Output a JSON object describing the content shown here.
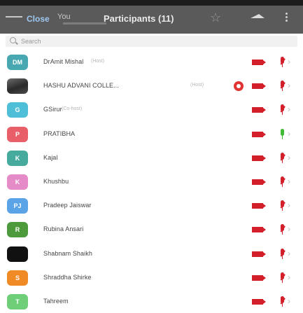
{
  "header": {
    "close_label": "Close",
    "you_label": "You",
    "title": "Participants (11)"
  },
  "search": {
    "placeholder": "Search"
  },
  "colors": {
    "header_bg": "#5a5a5a",
    "muted_red": "#d21f2a",
    "unmuted_green": "#3fba34"
  },
  "participants": [
    {
      "initials": "DM",
      "name": "DrAmit Mishal",
      "tag": "(Host)",
      "avatar_color": "#48a8b2",
      "avatar_type": "initials",
      "video": "off",
      "mic": "muted",
      "recording": false
    },
    {
      "initials": "",
      "name": "HASHU ADVANI COLLE...",
      "tag": "(Host)",
      "avatar_color": "#3a3a3a",
      "avatar_type": "photo",
      "video": "off",
      "mic": "muted",
      "recording": true
    },
    {
      "initials": "G",
      "name": "GSirur",
      "tag": "(Co-host)",
      "avatar_color": "#4fbfd8",
      "avatar_type": "initials",
      "video": "off",
      "mic": "muted",
      "recording": false
    },
    {
      "initials": "P",
      "name": "PRATIBHA",
      "tag": "",
      "avatar_color": "#e85f6a",
      "avatar_type": "initials",
      "video": "off",
      "mic": "unmuted",
      "recording": false
    },
    {
      "initials": "K",
      "name": "Kajal",
      "tag": "",
      "avatar_color": "#46ab9c",
      "avatar_type": "initials",
      "video": "off",
      "mic": "muted",
      "recording": false
    },
    {
      "initials": "K",
      "name": "Khushbu",
      "tag": "",
      "avatar_color": "#e48bc8",
      "avatar_type": "initials",
      "video": "off",
      "mic": "muted",
      "recording": false
    },
    {
      "initials": "PJ",
      "name": "Pradeep Jaiswar",
      "tag": "",
      "avatar_color": "#5aa3e6",
      "avatar_type": "initials",
      "video": "off",
      "mic": "muted",
      "recording": false
    },
    {
      "initials": "R",
      "name": "Rubina Ansari",
      "tag": "",
      "avatar_color": "#4d9a3c",
      "avatar_type": "initials",
      "video": "off",
      "mic": "muted",
      "recording": false
    },
    {
      "initials": "",
      "name": "Shabnam Shaikh",
      "tag": "",
      "avatar_color": "#111111",
      "avatar_type": "dark",
      "video": "off",
      "mic": "muted",
      "recording": false
    },
    {
      "initials": "S",
      "name": "Shraddha Shirke",
      "tag": "",
      "avatar_color": "#ef8a25",
      "avatar_type": "initials",
      "video": "off",
      "mic": "muted",
      "recording": false
    },
    {
      "initials": "T",
      "name": "Tahreem",
      "tag": "",
      "avatar_color": "#6fcf78",
      "avatar_type": "initials",
      "video": "off",
      "mic": "muted",
      "recording": false
    }
  ]
}
